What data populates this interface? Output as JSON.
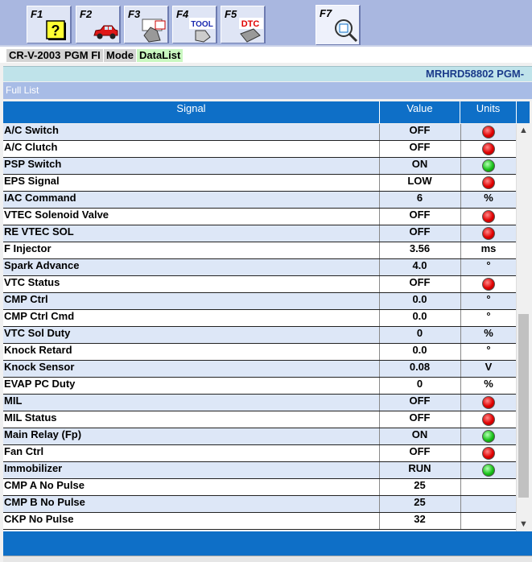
{
  "toolbar": {
    "buttons": [
      {
        "key": "F1",
        "icon": "help-question-icon"
      },
      {
        "key": "F2",
        "icon": "car-icon"
      },
      {
        "key": "F3",
        "icon": "pgm-at-icon"
      },
      {
        "key": "F4",
        "icon": "tool-icon"
      },
      {
        "key": "F5",
        "icon": "dtc-icon"
      },
      {
        "key": "F7",
        "icon": "datalist-magnifier-icon"
      }
    ]
  },
  "breadcrumb": {
    "model": "CR-V-2003",
    "system": "PGM FI",
    "mode": "Mode",
    "view": "DataList"
  },
  "vin_text": "MRHRD58802  PGM-",
  "list_title": "Full List",
  "table": {
    "headers": {
      "signal": "Signal",
      "value": "Value",
      "units": "Units"
    },
    "rows": [
      {
        "signal": "A/C Switch",
        "value": "OFF",
        "units": "",
        "led": "red"
      },
      {
        "signal": "A/C Clutch",
        "value": "OFF",
        "units": "",
        "led": "red"
      },
      {
        "signal": "PSP Switch",
        "value": "ON",
        "units": "",
        "led": "green"
      },
      {
        "signal": "EPS Signal",
        "value": "LOW",
        "units": "",
        "led": "red"
      },
      {
        "signal": "IAC Command",
        "value": "6",
        "units": "%",
        "led": ""
      },
      {
        "signal": "VTEC Solenoid Valve",
        "value": "OFF",
        "units": "",
        "led": "red"
      },
      {
        "signal": "RE VTEC SOL",
        "value": "OFF",
        "units": "",
        "led": "red"
      },
      {
        "signal": "F Injector",
        "value": "3.56",
        "units": "ms",
        "led": ""
      },
      {
        "signal": "Spark Advance",
        "value": "4.0",
        "units": "°",
        "led": ""
      },
      {
        "signal": "VTC Status",
        "value": "OFF",
        "units": "",
        "led": "red"
      },
      {
        "signal": "CMP Ctrl",
        "value": "0.0",
        "units": "°",
        "led": ""
      },
      {
        "signal": "CMP Ctrl Cmd",
        "value": "0.0",
        "units": "°",
        "led": ""
      },
      {
        "signal": "VTC Sol Duty",
        "value": "0",
        "units": "%",
        "led": ""
      },
      {
        "signal": "Knock Retard",
        "value": "0.0",
        "units": "°",
        "led": ""
      },
      {
        "signal": "Knock Sensor",
        "value": "0.08",
        "units": "V",
        "led": ""
      },
      {
        "signal": "EVAP PC Duty",
        "value": "0",
        "units": "%",
        "led": ""
      },
      {
        "signal": "MIL",
        "value": "OFF",
        "units": "",
        "led": "red"
      },
      {
        "signal": "MIL Status",
        "value": "OFF",
        "units": "",
        "led": "red"
      },
      {
        "signal": "Main Relay (Fp)",
        "value": "ON",
        "units": "",
        "led": "green"
      },
      {
        "signal": "Fan Ctrl",
        "value": "OFF",
        "units": "",
        "led": "red"
      },
      {
        "signal": "Immobilizer",
        "value": "RUN",
        "units": "",
        "led": "green"
      },
      {
        "signal": "CMP A No Pulse",
        "value": "25",
        "units": "",
        "led": ""
      },
      {
        "signal": "CMP B No Pulse",
        "value": "25",
        "units": "",
        "led": ""
      },
      {
        "signal": "CKP No Pulse",
        "value": "32",
        "units": "",
        "led": ""
      }
    ]
  },
  "scrollbar": {
    "up": "▲",
    "down": "▼"
  },
  "colors": {
    "header_blue": "#0e6fc7",
    "led_red": "#e00000",
    "led_green": "#18c218",
    "breadcrumb_green": "#c9f7c0"
  }
}
